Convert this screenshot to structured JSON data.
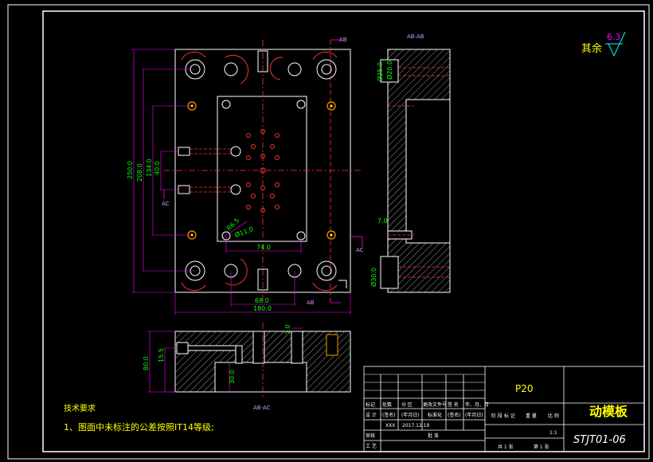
{
  "tolerance_note": "其余",
  "roughness_value": "6.3",
  "section_labels": {
    "top": "AB-AB",
    "bottom": "AB-AC"
  },
  "dimensions": {
    "overall_height": "250.0",
    "h208": "208.0",
    "h134": "134.0",
    "h40": "40.0",
    "w74": "74.0",
    "w68": "68.0",
    "w180": "180.0",
    "r6": "R6.5",
    "d11": "Ø11.0",
    "d25": "Ø25.0",
    "d20": "Ø20.0",
    "s7": "7.0",
    "d30": "Ø30.0",
    "b80": "80.0",
    "b15": "15.5",
    "b30": "30.0",
    "b7": "7.0"
  },
  "cut_labels": {
    "ab_top": "AB",
    "ab_bottom": "AB",
    "ac_left": "AC",
    "ac_right": "AC"
  },
  "tech_requirements": {
    "title": "技术要求",
    "item1": "1、图面中未标注的公差按照IT14等级;"
  },
  "title_block": {
    "material": "P20",
    "part_name": "动模板",
    "drawing_no": "STJT01-06",
    "scale": "1:1",
    "designer": "XXX",
    "date": "2017.12.19",
    "row_labels": [
      "标记",
      "处数",
      "分 区",
      "更改文件号",
      "签 名",
      "年、月、日"
    ],
    "row2_labels": [
      "设 计",
      "(签名)",
      "(年月日)",
      "标准化",
      "(签名)",
      "(年月日)"
    ],
    "col_labels": [
      "阶 段 标 记",
      "重 量",
      "比 例"
    ],
    "audit": "审核",
    "process": "工 艺",
    "approve": "批 准",
    "sheets_total": "共 1 张",
    "sheet_no": "第 1 张"
  }
}
